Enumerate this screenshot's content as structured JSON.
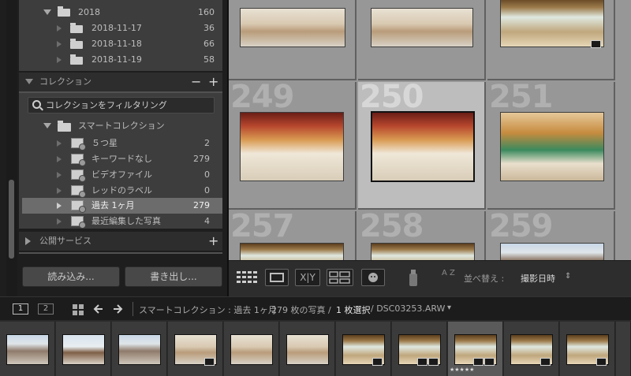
{
  "folders": {
    "year": {
      "label": "2018",
      "count": "160"
    },
    "items": [
      {
        "label": "2018-11-17",
        "count": "36"
      },
      {
        "label": "2018-11-18",
        "count": "66"
      },
      {
        "label": "2018-11-19",
        "count": "58"
      }
    ]
  },
  "collections": {
    "header": "コレクション",
    "minus": "−",
    "plus": "+",
    "filter_placeholder": "コレクションをフィルタリング",
    "smart_label": "スマートコレクション",
    "items": [
      {
        "label": "５つ星",
        "count": "2"
      },
      {
        "label": "キーワードなし",
        "count": "279"
      },
      {
        "label": "ビデオファイル",
        "count": "0"
      },
      {
        "label": "レッドのラベル",
        "count": "0"
      },
      {
        "label": "過去 1ヶ月",
        "count": "279"
      },
      {
        "label": "最近編集した写真",
        "count": "4"
      }
    ]
  },
  "publish": {
    "header": "公開サービス",
    "plus": "+"
  },
  "buttons": {
    "import": "読み込み...",
    "export": "書き出し..."
  },
  "grid": {
    "cells": [
      {
        "num": ""
      },
      {
        "num": ""
      },
      {
        "num": ""
      },
      {
        "num": "249"
      },
      {
        "num": "250"
      },
      {
        "num": "251"
      },
      {
        "num": "257"
      },
      {
        "num": "258"
      },
      {
        "num": "259"
      }
    ]
  },
  "toolbar": {
    "compare": "X|Y",
    "sort_az": "A Z",
    "sort_label": "並べ替え :",
    "sort_value": "撮影日時",
    "sort_arrow": "⇕"
  },
  "filmbar": {
    "screen1": "1",
    "screen2": "2",
    "path": "スマートコレクション : 過去 1ヶ月",
    "count": "279 枚の写真 /",
    "selected": "1 枚選択",
    "filename": "/ DSC03253.ARW",
    "dropdown": "▾"
  },
  "filmstrip": {
    "stars": "★★★★★"
  }
}
